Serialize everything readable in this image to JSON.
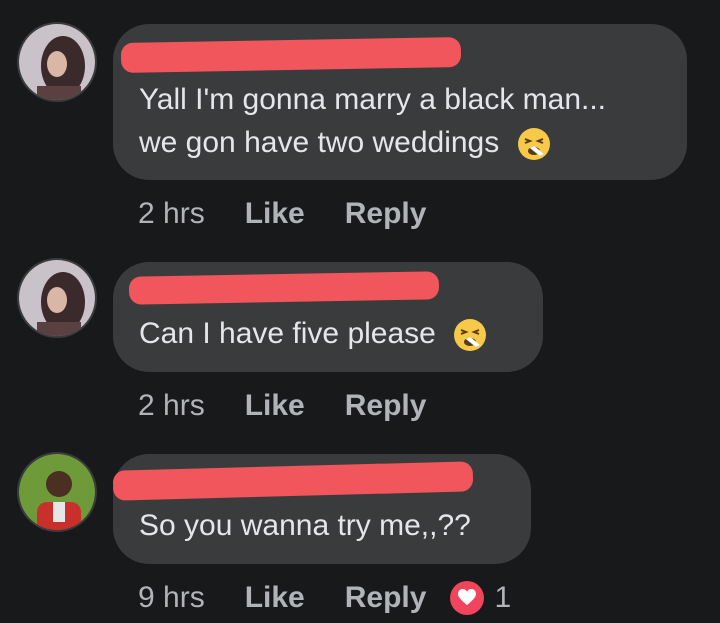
{
  "comments": [
    {
      "text_line1": "Yall I'm gonna marry a black man...",
      "text_line2": "we gon have two weddings",
      "emoji": "tired-face-emoji",
      "time": "2 hrs",
      "like_label": "Like",
      "reply_label": "Reply"
    },
    {
      "text_line1": "Can I have five please",
      "emoji": "tired-face-emoji",
      "time": "2 hrs",
      "like_label": "Like",
      "reply_label": "Reply"
    },
    {
      "text_line1": "So you wanna try me,,??",
      "time": "9 hrs",
      "like_label": "Like",
      "reply_label": "Reply",
      "reaction_icon": "love-heart-icon",
      "reaction_count": "1"
    }
  ],
  "colors": {
    "background": "#18191a",
    "bubble": "#3a3b3c",
    "redaction": "#f0565b",
    "secondary_text": "#b0b3b8",
    "love_reaction": "#f0455d"
  }
}
